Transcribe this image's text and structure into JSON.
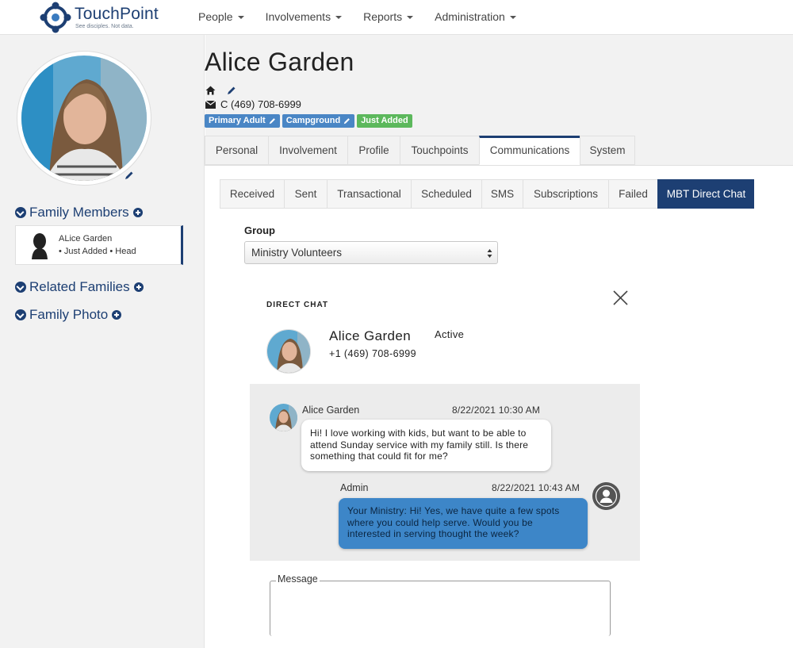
{
  "app": {
    "name": "TouchPoint",
    "tagline": "See disciples. Not data."
  },
  "nav": {
    "items": [
      {
        "label": "People"
      },
      {
        "label": "Involvements"
      },
      {
        "label": "Reports"
      },
      {
        "label": "Administration"
      }
    ]
  },
  "sidebar": {
    "family_members_label": "Family Members",
    "family_member": {
      "name": "ALice Garden",
      "details": "• Just Added • Head"
    },
    "related_families_label": "Related Families",
    "family_photo_label": "Family Photo"
  },
  "person": {
    "name": "Alice Garden",
    "phone": "C (469) 708-6999",
    "badges": [
      {
        "label": "Primary Adult",
        "color": "#4a86c5",
        "editable": true
      },
      {
        "label": "Campground",
        "color": "#4a86c5",
        "editable": true
      },
      {
        "label": "Just Added",
        "color": "#5cb85c",
        "editable": false
      }
    ]
  },
  "main_tabs": {
    "items": [
      {
        "label": "Personal"
      },
      {
        "label": "Involvement"
      },
      {
        "label": "Profile"
      },
      {
        "label": "Touchpoints"
      },
      {
        "label": "Communications"
      },
      {
        "label": "System"
      }
    ],
    "active": "Communications"
  },
  "sub_tabs": {
    "items": [
      {
        "label": "Received"
      },
      {
        "label": "Sent"
      },
      {
        "label": "Transactional"
      },
      {
        "label": "Scheduled"
      },
      {
        "label": "SMS"
      },
      {
        "label": "Subscriptions"
      },
      {
        "label": "Failed"
      },
      {
        "label": "MBT Direct Chat"
      }
    ],
    "active": "MBT Direct Chat"
  },
  "group": {
    "label": "Group",
    "selected": "Ministry Volunteers"
  },
  "chat": {
    "title": "DIRECT CHAT",
    "contact_name": "Alice Garden",
    "contact_status": "Active",
    "contact_phone": "+1 (469) 708-6999",
    "messages": [
      {
        "sender": "Alice Garden",
        "time": "8/22/2021 10:30 AM",
        "text": "Hi! I love working with kids, but want to be able to attend Sunday service with my family still. Is there something that could fit for me?",
        "direction": "incoming"
      },
      {
        "sender": "Admin",
        "time": "8/22/2021 10:43 AM",
        "text": "Your Ministry: Hi! Yes, we have quite a few spots where you could help serve. Would you be interested in serving thought the week?",
        "direction": "outgoing"
      }
    ],
    "message_label": "Message"
  },
  "colors": {
    "brand_navy": "#1d3f73",
    "badge_blue": "#4a86c5",
    "badge_green": "#5cb85c",
    "outgoing_bubble": "#3d86c8"
  }
}
